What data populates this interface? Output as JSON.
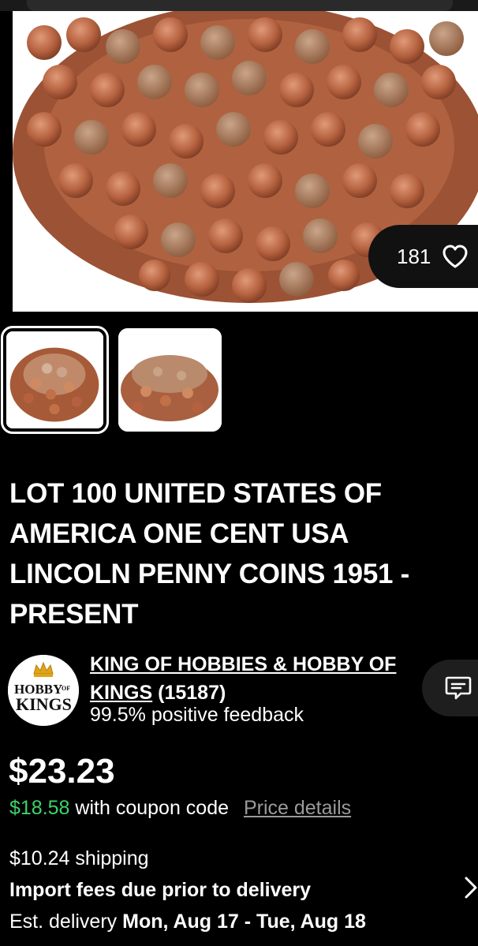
{
  "hero": {
    "like_count": "181",
    "like_icon": "heart-outline-icon"
  },
  "thumbnails": [
    "coin-pile-top-view",
    "coin-pile-side-view"
  ],
  "listing": {
    "title": "LOT 100 UNITED STATES OF AMERICA ONE CENT USA LINCOLN PENNY COINS 1951 - PRESENT"
  },
  "seller": {
    "logo_line1": "HOBBY",
    "logo_of": "OF",
    "logo_line2": "KINGS",
    "name_part1": "KING OF HOBBIES & HOBBY OF",
    "name_part2": "KINGS",
    "feedback_count": "(15187)",
    "feedback_text": "99.5% positive feedback",
    "message_icon": "chat-bubble-icon"
  },
  "pricing": {
    "price": "$23.23",
    "coupon_price": "$18.58",
    "coupon_text": "with coupon code",
    "price_details": "Price details",
    "coupon_color": "#3dd26a"
  },
  "shipping": {
    "cost": "$10.24 shipping",
    "import_fees": "Import fees due prior to delivery",
    "delivery_label": "Est. delivery",
    "delivery_dates": "Mon, Aug 17 - Tue, Aug 18"
  }
}
